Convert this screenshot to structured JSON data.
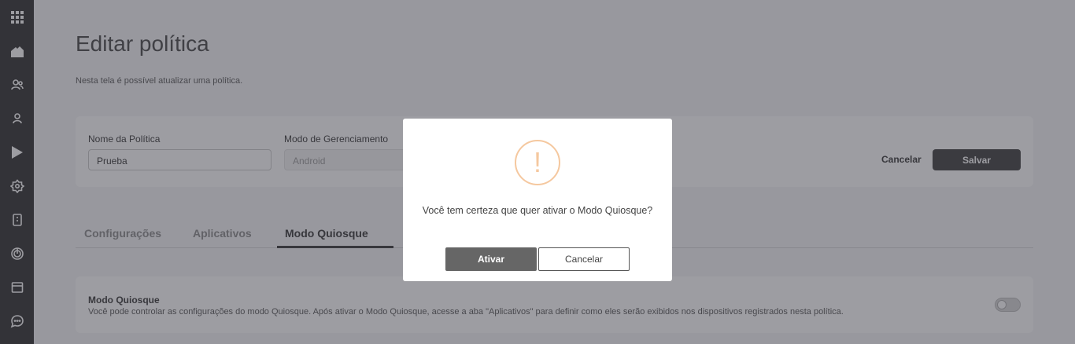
{
  "sidebar": {
    "items": [
      {
        "icon": "apps-grid-icon"
      },
      {
        "icon": "home-icon"
      },
      {
        "icon": "users-icon"
      },
      {
        "icon": "user-icon"
      },
      {
        "icon": "play-store-icon"
      },
      {
        "icon": "badge-icon"
      },
      {
        "icon": "device-icon"
      },
      {
        "icon": "radar-icon"
      },
      {
        "icon": "calendar-icon"
      },
      {
        "icon": "chat-icon"
      }
    ]
  },
  "page": {
    "title": "Editar política",
    "subtitle": "Nesta tela é possível atualizar uma política."
  },
  "form": {
    "policy_name_label": "Nome da Política",
    "policy_name_value": "Prueba",
    "management_mode_label": "Modo de Gerenciamento",
    "management_mode_value": "Android",
    "cancel_label": "Cancelar",
    "save_label": "Salvar"
  },
  "tabs": [
    {
      "label": "Configurações",
      "active": false
    },
    {
      "label": "Aplicativos",
      "active": false
    },
    {
      "label": "Modo Quiosque",
      "active": true
    }
  ],
  "kiosk": {
    "title": "Modo Quiosque",
    "description": "Você pode controlar as configurações do modo Quiosque. Após ativar o Modo Quiosque, acesse a aba \"Aplicativos\" para definir como eles serão exibidos nos dispositivos registrados nesta política.",
    "enabled": false
  },
  "modal": {
    "icon": "!",
    "message": "Você tem certeza que quer ativar o Modo Quiosque?",
    "confirm_label": "Ativar",
    "cancel_label": "Cancelar"
  },
  "colors": {
    "sidebar_bg": "#2b2b2b",
    "primary_button": "#3b3b3b",
    "warning_accent": "#f5c89f"
  }
}
